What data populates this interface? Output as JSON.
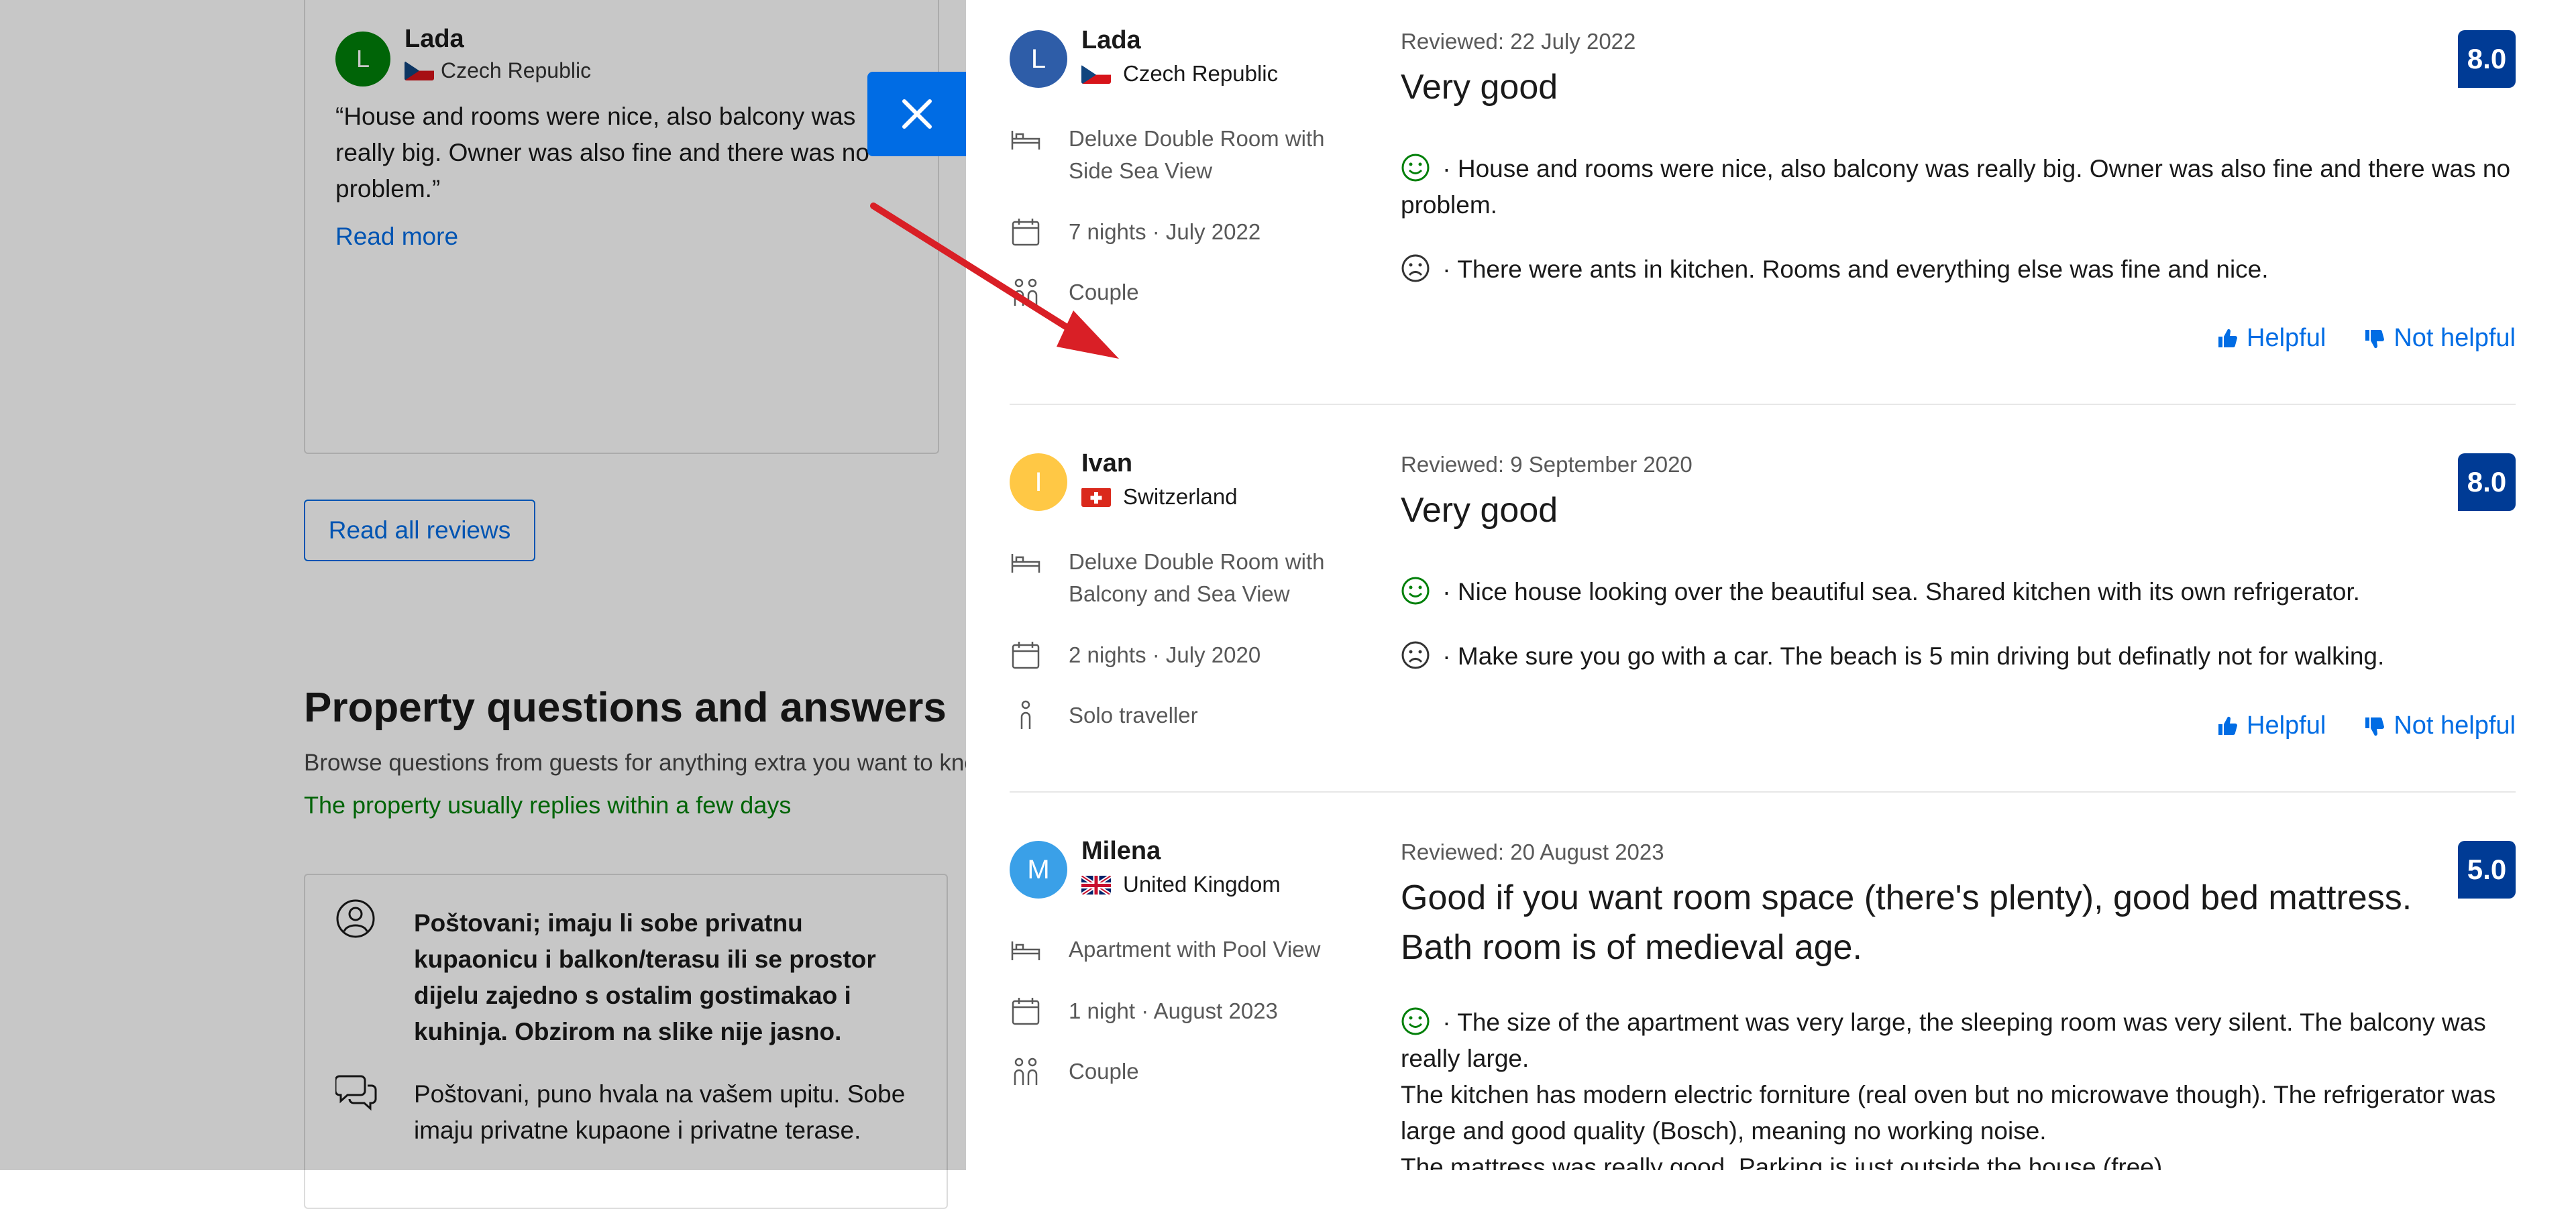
{
  "background": {
    "review_card": {
      "avatar_initial": "L",
      "name": "Lada",
      "country": "Czech Republic",
      "quote": "“House and rooms were nice, also balcony was really big. Owner was also fine and there was no problem.”",
      "read_more": "Read more"
    },
    "read_all_reviews": "Read all reviews",
    "qa": {
      "title": "Property questions and answers",
      "subtitle": "Browse questions from guests for anything extra you want to know",
      "reply_note": "The property usually replies within a few days",
      "question": "Poštovani; imaju li sobe privatnu kupaonicu i balkon/terasu ili se prostor dijelu zajedno s ostalim gostimakao i kuhinja. Obzirom na slike nije jasno.",
      "answer": "Poštovani, puno hvala na vašem upitu. Sobe imaju privatne kupaone i privatne terase."
    }
  },
  "colors": {
    "accent": "#006ce4",
    "score_bg": "#003b95",
    "positive": "#008009"
  },
  "reviews": [
    {
      "initial": "L",
      "avatar_color": "#2e5da8",
      "name": "Lada",
      "country": "Czech Republic",
      "room": "Deluxe Double Room with Side Sea View",
      "stay": "7 nights ·  July 2022",
      "traveller": "Couple",
      "date": "Reviewed: 22 July 2022",
      "title": "Very good",
      "score": "8.0",
      "positive": " · House and rooms were nice, also balcony was really big. Owner was also fine and there was no problem.",
      "negative": " · There were ants in kitchen. Rooms and everything else was fine and nice.",
      "helpful": "Helpful",
      "not_helpful": "Not helpful"
    },
    {
      "initial": "I",
      "avatar_color": "#ffc845",
      "name": "Ivan",
      "country": "Switzerland",
      "room": "Deluxe Double Room with Balcony and Sea View",
      "stay": "2 nights ·  July 2020",
      "traveller": "Solo traveller",
      "date": "Reviewed: 9 September 2020",
      "title": "Very good",
      "score": "8.0",
      "positive": " · Nice house looking over the beautiful sea. Shared kitchen with its own refrigerator.",
      "negative": " · Make sure you go with a car. The beach is 5 min driving but definatly not for walking.",
      "helpful": "Helpful",
      "not_helpful": "Not helpful"
    },
    {
      "initial": "M",
      "avatar_color": "#3aa0e8",
      "name": "Milena",
      "country": "United Kingdom",
      "room": "Apartment with Pool View",
      "stay": "1 night ·  August 2023",
      "traveller": "Couple",
      "date": "Reviewed: 20 August 2023",
      "title": "Good if you want room space (there's plenty), good bed mattress. Bath room is of medieval age.",
      "score": "5.0",
      "positive": " · The size of the apartment was very large, the sleeping room was very silent. The balcony was really large.",
      "positive_2": "The kitchen has modern electric forniture (real oven but no microwave though). The refrigerator was large and good quality (Bosch), meaning no working noise.",
      "positive_3": "The mattress was really good. Parking is just outside the house (free)."
    }
  ],
  "icons": {
    "close": "close-icon",
    "bed": "bed-icon",
    "calendar": "calendar-icon",
    "couple": "people-icon",
    "solo": "person-icon",
    "happy": "happy-face-icon",
    "sad": "sad-face-icon",
    "thumb_up": "thumbs-up-icon",
    "thumb_down": "thumbs-down-icon"
  }
}
